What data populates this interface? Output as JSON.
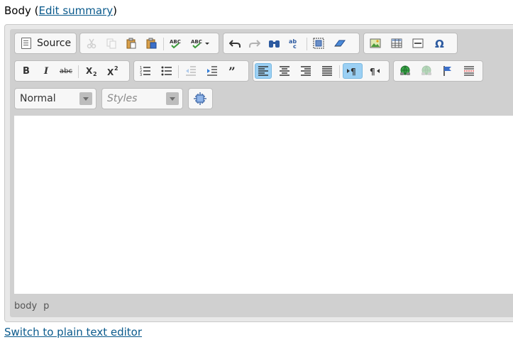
{
  "field": {
    "label": "Body",
    "open_paren": "(",
    "edit_summary_link": "Edit summary",
    "close_paren": ")"
  },
  "toolbar": {
    "source_label": "Source",
    "format_combo": "Normal",
    "styles_combo": "Styles"
  },
  "status_bar": {
    "path": [
      "body",
      "p"
    ]
  },
  "switch_link": "Switch to plain text editor",
  "colors": {
    "link": "#0a5a8c",
    "active_button": "#9bd0f4",
    "toolbar_bg": "#d0d0d0"
  }
}
